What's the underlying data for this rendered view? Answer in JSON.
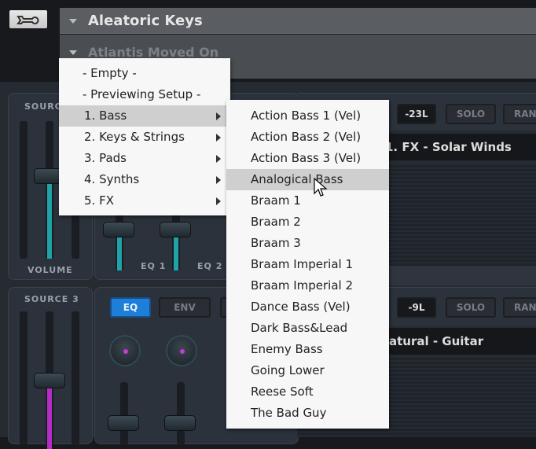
{
  "header": {
    "instrument": "Aleatoric Keys",
    "preset": "Atlantis Moved On"
  },
  "source1": {
    "label": "SOURCE",
    "volume_label": "VOLUME",
    "eq1": "EQ 1",
    "eq2": "EQ 2"
  },
  "source3": {
    "label": "SOURCE 3",
    "tabs": [
      "EQ",
      "ENV"
    ]
  },
  "slot1": {
    "level": "-23L",
    "solo": "SOLO",
    "random": "RAN",
    "name": "1. FX - Solar Winds"
  },
  "slot2": {
    "level": "-9L",
    "solo": "SOLO",
    "random": "RAN",
    "name": "atural - Guitar Octaver"
  },
  "menu": {
    "items": [
      {
        "label": "- Empty -"
      },
      {
        "label": "- Previewing Setup -"
      },
      {
        "label": "1. Bass",
        "selected": true
      },
      {
        "label": "2. Keys & Strings"
      },
      {
        "label": "3. Pads"
      },
      {
        "label": "4. Synths"
      },
      {
        "label": "5. FX"
      }
    ]
  },
  "submenu": {
    "items": [
      "Action Bass 1 (Vel)",
      "Action Bass 2 (Vel)",
      "Action Bass 3 (Vel)",
      "Analogical Bass",
      "Braam 1",
      "Braam 2",
      "Braam 3",
      "Braam Imperial 1",
      "Braam Imperial 2",
      "Dance Bass (Vel)",
      "Dark Bass&Lead",
      "Enemy Bass",
      "Going Lower",
      "Reese Soft",
      "The Bad Guy"
    ],
    "hovered": "Analogical Bass"
  },
  "colors": {
    "accent_blue": "#1e7fd8",
    "teal": "#1fa3a8",
    "magenta": "#b32cc6"
  }
}
